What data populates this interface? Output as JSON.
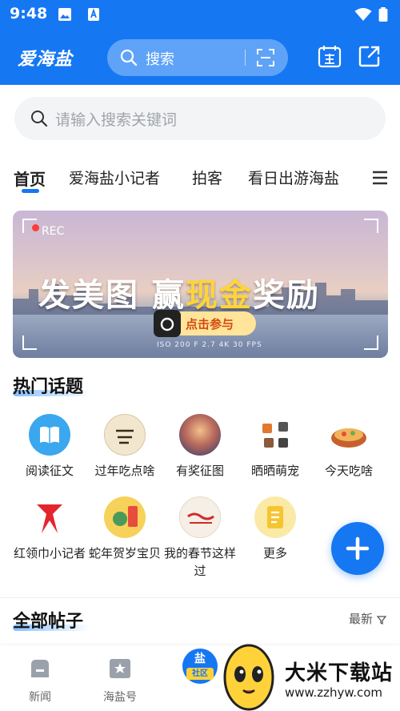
{
  "status_bar": {
    "time": "9:48"
  },
  "header": {
    "logo": "爱海盐",
    "search_label": "搜索",
    "brand_color": "#1677f3"
  },
  "sub_search": {
    "placeholder": "请输入搜索关键词"
  },
  "tabs": [
    {
      "label": "首页",
      "active": true
    },
    {
      "label": "爱海盐小记者",
      "active": false
    },
    {
      "label": "拍客",
      "active": false
    },
    {
      "label": "看日出游海盐",
      "active": false
    }
  ],
  "banner": {
    "rec": "REC",
    "headline_a": "发美图 赢",
    "headline_b": "现金",
    "headline_c": "奖励",
    "cta": "点击参与",
    "meta": "ISO 200   F 2.7   4K   30 FPS"
  },
  "hot_topics": {
    "title": "热门话题",
    "items": [
      {
        "label": "阅读征文",
        "icon": "book-icon"
      },
      {
        "label": "过年吃点啥",
        "icon": "new-year-food-icon"
      },
      {
        "label": "有奖征图",
        "icon": "photo-contest-icon"
      },
      {
        "label": "晒晒萌宠",
        "icon": "pet-icon"
      },
      {
        "label": "今天吃啥",
        "icon": "food-bowl-icon"
      },
      {
        "label": "红领巾小记者",
        "icon": "red-scarf-icon"
      },
      {
        "label": "蛇年贺岁宝贝",
        "icon": "snake-year-icon"
      },
      {
        "label": "我的春节这样过",
        "icon": "spring-festival-icon"
      },
      {
        "label": "更多",
        "icon": "more-icon"
      }
    ]
  },
  "posts": {
    "title": "全部帖子",
    "sort_label": "最新"
  },
  "bottom_nav": [
    {
      "label": "新闻",
      "icon": "news-icon"
    },
    {
      "label": "海盐号",
      "icon": "star-icon"
    }
  ],
  "center_badge": {
    "line1": "盐",
    "line2": "社区"
  },
  "watermark": {
    "text": "大米下载站",
    "url": "www.zzhyw.com"
  }
}
